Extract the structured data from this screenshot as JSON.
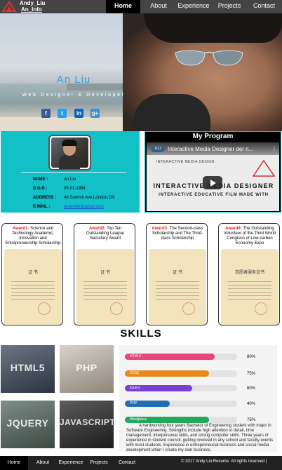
{
  "brand": {
    "name": "Andy_Liu",
    "info": "An_Info"
  },
  "nav": {
    "items": [
      {
        "label": "Home",
        "active": true
      },
      {
        "label": "About"
      },
      {
        "label": "Experience"
      },
      {
        "label": "Projects"
      },
      {
        "label": "Contact"
      }
    ]
  },
  "hero": {
    "name": "An Liu",
    "role": "Web Designer & Developer",
    "social": [
      {
        "icon": "facebook-icon",
        "glyph": "f",
        "color": "#3b5998"
      },
      {
        "icon": "twitter-icon",
        "glyph": "t",
        "color": "#1da1f2"
      },
      {
        "icon": "linkedin-icon",
        "glyph": "in",
        "color": "#0a66c2"
      },
      {
        "icon": "google-plus-icon",
        "glyph": "g+",
        "color": "#3b8fd8"
      }
    ]
  },
  "profile": {
    "rows": [
      {
        "label": "NAME :",
        "value": "An Liu"
      },
      {
        "label": "D.O.B :",
        "value": "05-01-1994"
      },
      {
        "label": "ADDRESS :",
        "value": "40 Summit Ave,London,ON"
      },
      {
        "label": "E-MAIL :",
        "value": "andyville@gmail.com"
      }
    ]
  },
  "program": {
    "title": "My Program",
    "video_title": "Interactive Media Designer der n...",
    "video_logo": "ILLI",
    "video_caption_small": "INTERACTIVE MEDIA DESIGN",
    "video_big": "INTERACTIVE MEDIA DESIGNER",
    "video_sub": "INTERACTIVE EDUCATIVE FILM MADE WITH"
  },
  "awards": [
    {
      "tag": "Award1:",
      "text": " Science and Technology Academic, Innovation and Entrepreneurship Scholarship",
      "cert_title": "证 书"
    },
    {
      "tag": "Award2:",
      "text": " Top Ten Outstanding League Secretary Award",
      "cert_title": "证 书"
    },
    {
      "tag": "Award3:",
      "text": " The Second-class Scholarship and The Third-class Scholarship",
      "cert_title": "证 书"
    },
    {
      "tag": "Award4:",
      "text": " The Outstanding Volunteer of the Third World Congress of Low-carbon Economy Expo",
      "cert_title": "志愿者服务证书"
    }
  ],
  "skills": {
    "title": "SKILLS",
    "tiles": [
      "HTML5",
      "PHP",
      "JQUERY",
      "JAVASCRIPT"
    ],
    "bars": [
      {
        "name": "HTML5",
        "percent": 80,
        "label": "80%",
        "color": "#e8457c"
      },
      {
        "name": "CSS3",
        "percent": 75,
        "label": "75%",
        "color": "#e8891c"
      },
      {
        "name": "jQuery",
        "percent": 60,
        "label": "60%",
        "color": "#7b3fd1"
      },
      {
        "name": "PHP",
        "percent": 40,
        "label": "40%",
        "color": "#1f6fb3"
      },
      {
        "name": "Wordpress",
        "percent": 75,
        "label": "75%",
        "color": "#22a85a"
      }
    ],
    "description": "A hardworking four years Bachelor of Engineering student with major in Software Engineering. Strengths include high attention to detail, time management, interpersonal skills, and strong computer skills. Three years of experience in student council, getting involved in any school and faculty events with most students. Experience in entrepreneurial business and social media development when I create my own business."
  },
  "footer": {
    "items": [
      "Home",
      "About",
      "Experience",
      "Projects",
      "Contact"
    ],
    "copyright": "© 2017 Andy Liu Resume. All rights reserved |"
  }
}
